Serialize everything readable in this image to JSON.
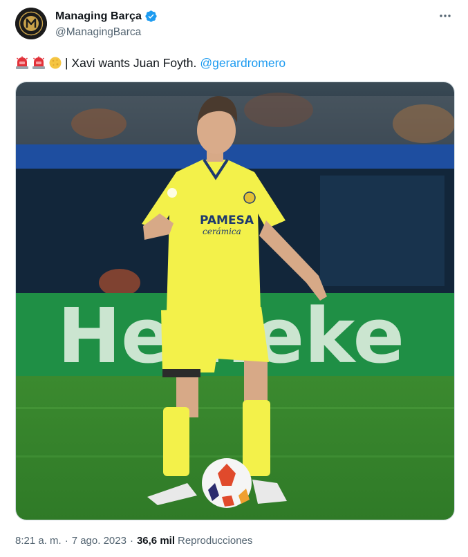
{
  "author": {
    "display_name": "Managing Barça",
    "handle": "@ManagingBarca",
    "avatar_text": "M",
    "verified": true
  },
  "tweet": {
    "emojis": [
      "police-light-emoji",
      "police-light-emoji",
      "sun-emoji"
    ],
    "text": "| Xavi wants Juan Foyth.",
    "mention": "@gerardromero"
  },
  "media": {
    "description_icon": "photo-football-player",
    "shirt_sponsor_line1": "PAMESA",
    "shirt_sponsor_line2": "cerámica",
    "board_text": "Heineke"
  },
  "meta": {
    "time": "8:21 a. m.",
    "separator": "·",
    "date": "7 ago. 2023",
    "views_count": "36,6 mil",
    "views_label": "Reproducciones"
  },
  "colors": {
    "text_primary": "#0f1419",
    "text_secondary": "#536471",
    "link": "#1d9bf0",
    "verified": "#1d9bf0",
    "kit_yellow": "#f3f14a"
  }
}
